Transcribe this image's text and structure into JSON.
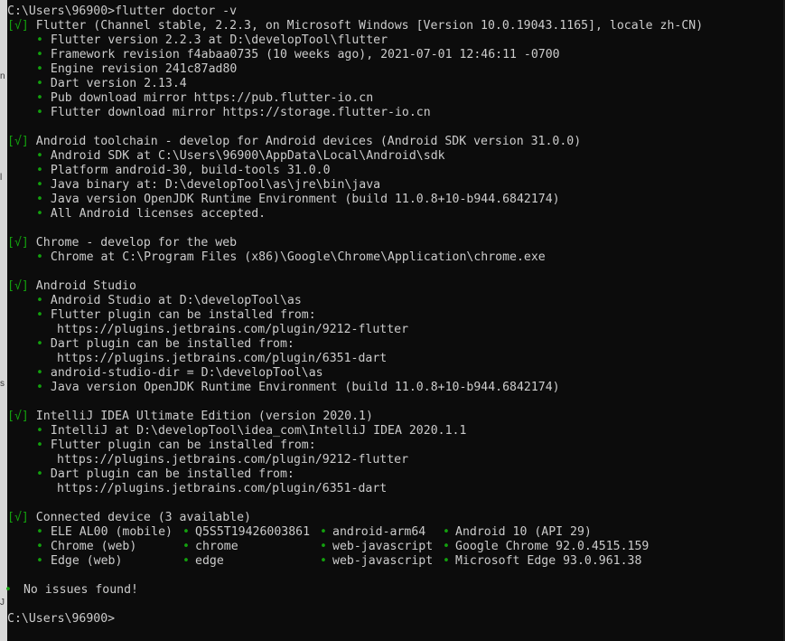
{
  "prompt": "C:\\Users\\96900>",
  "command": "flutter doctor -v",
  "sections": [
    {
      "check": "[√]",
      "title": "Flutter (Channel stable, 2.2.3, on Microsoft Windows [Version 10.0.19043.1165], locale zh-CN)",
      "lines": [
        {
          "text": "Flutter version 2.2.3 at D:\\developTool\\flutter",
          "indent": 1
        },
        {
          "text": "Framework revision f4abaa0735 (10 weeks ago), 2021-07-01 12:46:11 -0700",
          "indent": 1
        },
        {
          "text": "Engine revision 241c87ad80",
          "indent": 1
        },
        {
          "text": "Dart version 2.13.4",
          "indent": 1
        },
        {
          "text": "Pub download mirror https://pub.flutter-io.cn",
          "indent": 1
        },
        {
          "text": "Flutter download mirror https://storage.flutter-io.cn",
          "indent": 1
        }
      ]
    },
    {
      "check": "[√]",
      "title": "Android toolchain - develop for Android devices (Android SDK version 31.0.0)",
      "lines": [
        {
          "text": "Android SDK at C:\\Users\\96900\\AppData\\Local\\Android\\sdk",
          "indent": 1
        },
        {
          "text": "Platform android-30, build-tools 31.0.0",
          "indent": 1
        },
        {
          "text": "Java binary at: D:\\developTool\\as\\jre\\bin\\java",
          "indent": 1
        },
        {
          "text": "Java version OpenJDK Runtime Environment (build 11.0.8+10-b944.6842174)",
          "indent": 1
        },
        {
          "text": "All Android licenses accepted.",
          "indent": 1
        }
      ]
    },
    {
      "check": "[√]",
      "title": "Chrome - develop for the web",
      "lines": [
        {
          "text": "Chrome at C:\\Program Files (x86)\\Google\\Chrome\\Application\\chrome.exe",
          "indent": 1
        }
      ]
    },
    {
      "check": "[√]",
      "title": "Android Studio",
      "lines": [
        {
          "text": "Android Studio at D:\\developTool\\as",
          "indent": 1
        },
        {
          "text": "Flutter plugin can be installed from:",
          "indent": 1
        },
        {
          "text": "https://plugins.jetbrains.com/plugin/9212-flutter",
          "indent": 2
        },
        {
          "text": "Dart plugin can be installed from:",
          "indent": 1
        },
        {
          "text": "https://plugins.jetbrains.com/plugin/6351-dart",
          "indent": 2
        },
        {
          "text": "android-studio-dir = D:\\developTool\\as",
          "indent": 1
        },
        {
          "text": "Java version OpenJDK Runtime Environment (build 11.0.8+10-b944.6842174)",
          "indent": 1
        }
      ]
    },
    {
      "check": "[√]",
      "title": "IntelliJ IDEA Ultimate Edition (version 2020.1)",
      "lines": [
        {
          "text": "IntelliJ at D:\\developTool\\idea_com\\IntelliJ IDEA 2020.1.1",
          "indent": 1
        },
        {
          "text": "Flutter plugin can be installed from:",
          "indent": 1
        },
        {
          "text": "https://plugins.jetbrains.com/plugin/9212-flutter",
          "indent": 2
        },
        {
          "text": "Dart plugin can be installed from:",
          "indent": 1
        },
        {
          "text": "https://plugins.jetbrains.com/plugin/6351-dart",
          "indent": 2
        }
      ]
    },
    {
      "check": "[√]",
      "title": "Connected device (3 available)",
      "devices": [
        {
          "name": "ELE AL00 (mobile)",
          "id": "Q5S5T19426003861",
          "arch": "android-arm64",
          "os": "Android 10 (API 29)"
        },
        {
          "name": "Chrome (web)",
          "id": "chrome",
          "arch": "web-javascript",
          "os": "Google Chrome 92.0.4515.159"
        },
        {
          "name": "Edge (web)",
          "id": "edge",
          "arch": "web-javascript",
          "os": "Microsoft Edge 93.0.961.38"
        }
      ]
    }
  ],
  "summary": "No issues found!",
  "final_prompt": "C:\\Users\\96900>",
  "bullet_glyph": "•",
  "colors": {
    "background": "#0c0c0c",
    "text": "#cccccc",
    "accent_green": "#13a10e"
  }
}
